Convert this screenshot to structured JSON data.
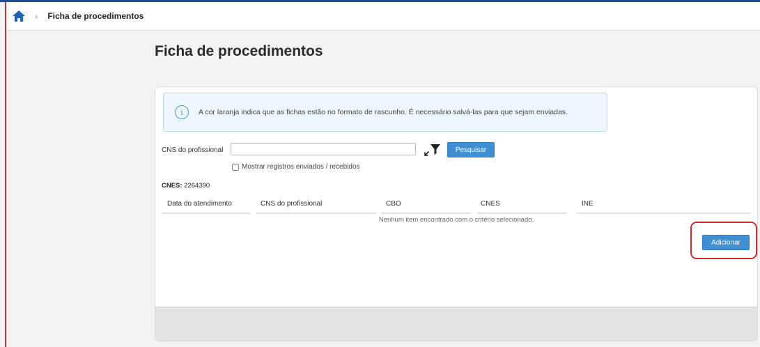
{
  "breadcrumb": {
    "current": "Ficha de procedimentos",
    "separator": "›"
  },
  "page": {
    "title": "Ficha de procedimentos"
  },
  "alert": {
    "icon": "info-icon",
    "text": "A cor laranja indica que as fichas estão no formato de rascunho. É necessário salvá-las para que sejam enviadas."
  },
  "filter": {
    "cns_label": "CNS do profissional",
    "cns_value": "",
    "search_label": "Pesquisar",
    "checkbox_label": "Mostrar registros enviados / recebidos",
    "checkbox_checked": false
  },
  "cnes": {
    "key": "CNES:",
    "value": "2264390"
  },
  "table": {
    "columns": [
      "Data do atendimento",
      "CNS do profissional",
      "CBO",
      "CNES",
      "INE"
    ],
    "rows": [],
    "empty_message": "Nenhum item encontrado com o critério selecionado."
  },
  "actions": {
    "add_label": "Adicionar"
  },
  "colors": {
    "accent": "#3f8fd2",
    "nav": "#2b4a96",
    "highlight": "#d12a2a",
    "info": "#4a9ac8"
  }
}
